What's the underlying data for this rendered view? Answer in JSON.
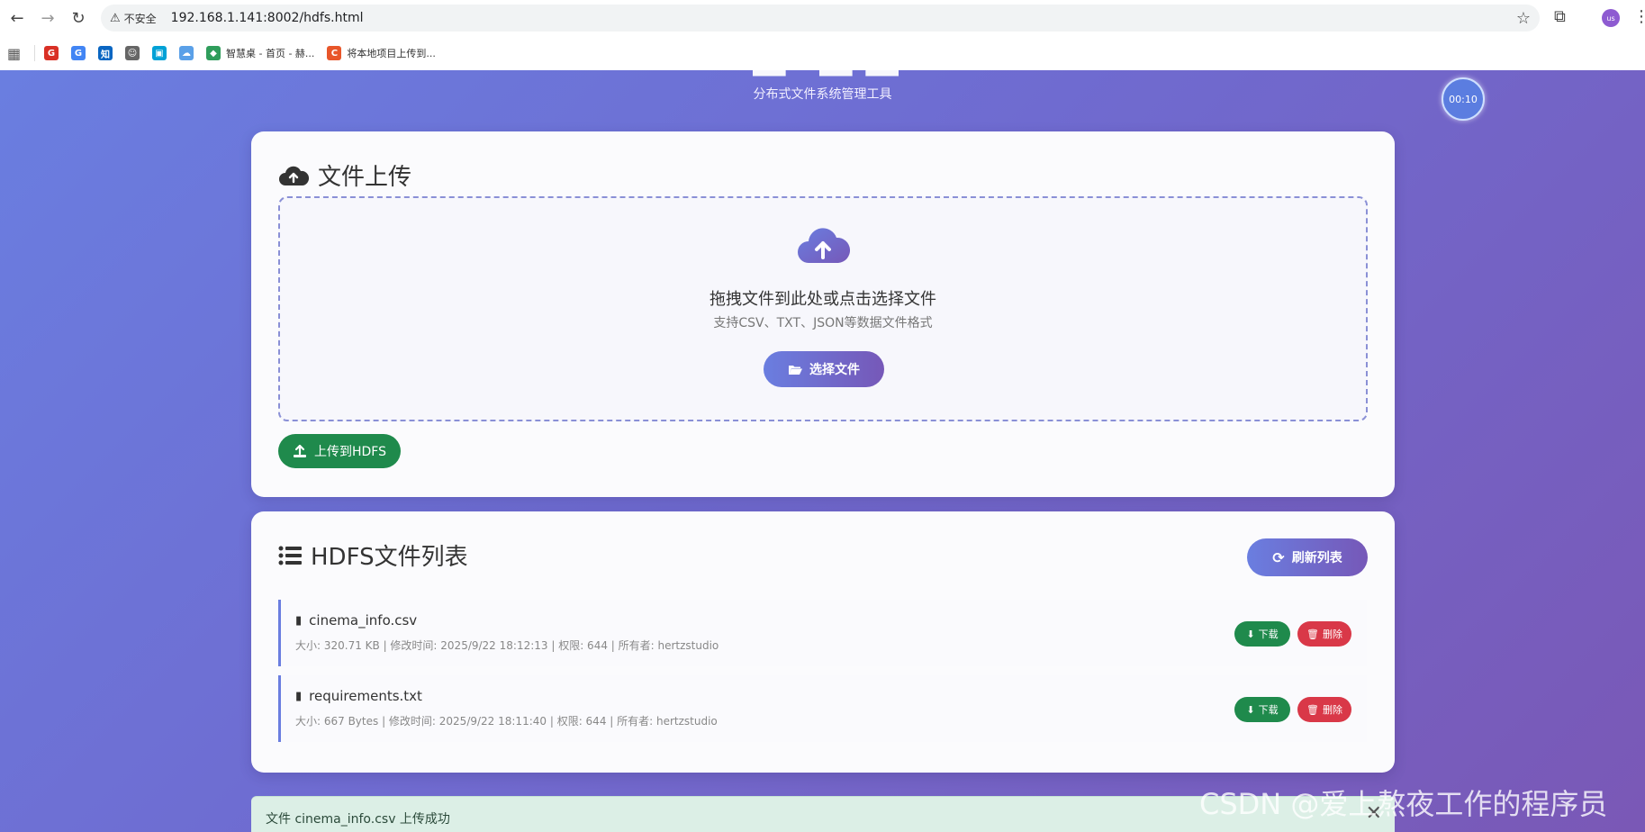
{
  "browser": {
    "security_label": "不安全",
    "url": "192.168.1.141:8002/hdfs.html",
    "profile_initials": "us",
    "bookmarks": [
      {
        "label": "",
        "icon": "G",
        "color": "#d93025"
      },
      {
        "label": "",
        "icon": "G",
        "color": "#4285f4"
      },
      {
        "label": "",
        "icon": "知",
        "color": "#0a66c2"
      },
      {
        "label": "",
        "icon": "☺",
        "color": "#666666"
      },
      {
        "label": "",
        "icon": "▣",
        "color": "#00a1d6"
      },
      {
        "label": "",
        "icon": "☁",
        "color": "#5aa0e8"
      },
      {
        "label": "智慧桌 - 首页 - 赫...",
        "icon": "◆",
        "color": "#2f9d5b"
      },
      {
        "label": "将本地项目上传到...",
        "icon": "C",
        "color": "#e8562a"
      }
    ]
  },
  "header": {
    "subtitle": "分布式文件系统管理工具",
    "timer": "00:10"
  },
  "upload": {
    "title": "文件上传",
    "drop_title": "拖拽文件到此处或点击选择文件",
    "drop_hint": "支持CSV、TXT、JSON等数据文件格式",
    "choose_label": "选择文件",
    "upload_label": "上传到HDFS"
  },
  "list": {
    "title": "HDFS文件列表",
    "refresh_label": "刷新列表",
    "download_label": "下载",
    "delete_label": "删除",
    "files": [
      {
        "name": "cinema_info.csv",
        "meta": "大小: 320.71 KB | 修改时间: 2025/9/22 18:12:13 | 权限: 644 | 所有者: hertzstudio"
      },
      {
        "name": "requirements.txt",
        "meta": "大小: 667 Bytes | 修改时间: 2025/9/22 18:11:40 | 权限: 644 | 所有者: hertzstudio"
      }
    ]
  },
  "toast": {
    "message": "文件 cinema_info.csv 上传成功",
    "close": "✕"
  },
  "watermark": "CSDN @爱上熬夜工作的程序员",
  "colors": {
    "accent": "#6a7ee0",
    "success": "#1f8a4c",
    "danger": "#d93848"
  }
}
